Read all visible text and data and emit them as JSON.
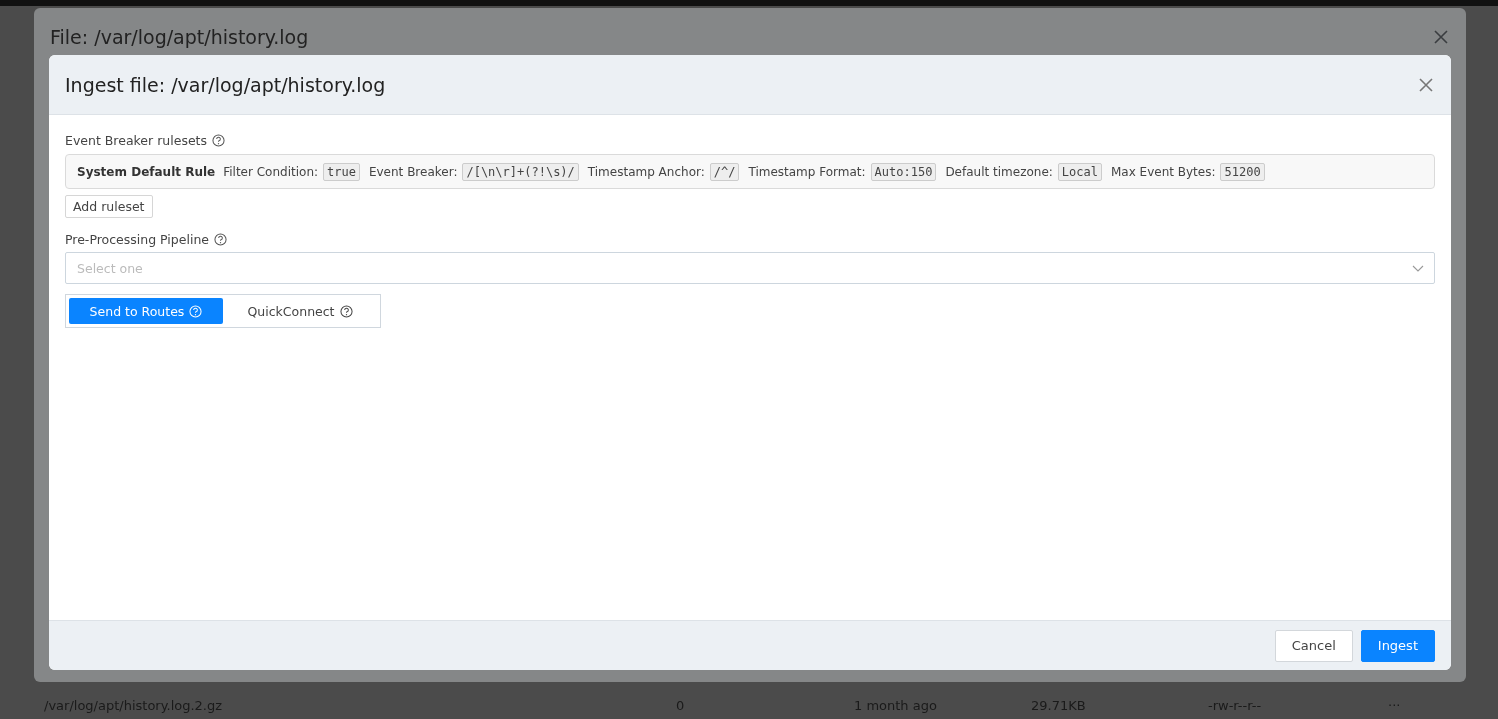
{
  "background_row": {
    "name": "/var/log/apt/history.log.2.gz",
    "count": "0",
    "modified": "1 month ago",
    "size": "29.71KB",
    "permissions": "-rw-r--r--",
    "more": "···"
  },
  "file_dialog": {
    "title": "File: /var/log/apt/history.log"
  },
  "ingest_dialog": {
    "title": "Ingest file: /var/log/apt/history.log",
    "rulesets_label": "Event Breaker rulesets",
    "ruleset": {
      "name": "System Default Rule",
      "fields": [
        {
          "label": "Filter Condition:",
          "value": "true"
        },
        {
          "label": "Event Breaker:",
          "value": "/[\\n\\r]+(?!\\s)/"
        },
        {
          "label": "Timestamp Anchor:",
          "value": "/^/"
        },
        {
          "label": "Timestamp Format:",
          "value": "Auto:150"
        },
        {
          "label": "Default timezone:",
          "value": "Local"
        },
        {
          "label": "Max Event Bytes:",
          "value": "51200"
        }
      ]
    },
    "add_ruleset": "Add ruleset",
    "pipeline_label": "Pre-Processing Pipeline",
    "pipeline": {
      "placeholder": "Select one"
    },
    "modes": [
      {
        "label": "Send to Routes",
        "selected": true
      },
      {
        "label": "QuickConnect",
        "selected": false
      }
    ],
    "buttons": [
      {
        "label": "Cancel",
        "kind": "secondary"
      },
      {
        "label": "Ingest",
        "kind": "primary"
      }
    ]
  }
}
